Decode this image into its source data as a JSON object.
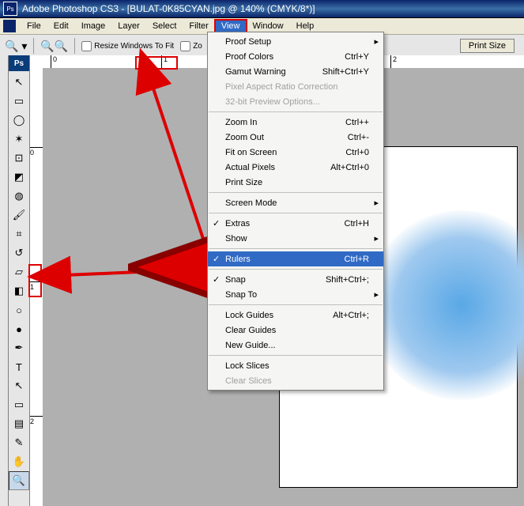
{
  "titlebar": {
    "icon": "Ps",
    "text": "Adobe Photoshop CS3 - [BULAT-0K85CYAN.jpg @ 140% (CMYK/8*)]"
  },
  "menubar": {
    "items": [
      "File",
      "Edit",
      "Image",
      "Layer",
      "Select",
      "Filter",
      "View",
      "Window",
      "Help"
    ],
    "active": 6
  },
  "optionsbar": {
    "resize": "Resize Windows To Fit",
    "zoom": "Zo",
    "printsize": "Print Size"
  },
  "view_menu": {
    "groups": [
      [
        {
          "label": "Proof Setup",
          "shortcut": "",
          "sub": true
        },
        {
          "label": "Proof Colors",
          "shortcut": "Ctrl+Y"
        },
        {
          "label": "Gamut Warning",
          "shortcut": "Shift+Ctrl+Y"
        },
        {
          "label": "Pixel Aspect Ratio Correction",
          "disabled": true
        },
        {
          "label": "32-bit Preview Options...",
          "disabled": true
        }
      ],
      [
        {
          "label": "Zoom In",
          "shortcut": "Ctrl++"
        },
        {
          "label": "Zoom Out",
          "shortcut": "Ctrl+-"
        },
        {
          "label": "Fit on Screen",
          "shortcut": "Ctrl+0"
        },
        {
          "label": "Actual Pixels",
          "shortcut": "Alt+Ctrl+0"
        },
        {
          "label": "Print Size"
        }
      ],
      [
        {
          "label": "Screen Mode",
          "sub": true
        }
      ],
      [
        {
          "label": "Extras",
          "shortcut": "Ctrl+H",
          "check": true
        },
        {
          "label": "Show",
          "sub": true
        }
      ],
      [
        {
          "label": "Rulers",
          "shortcut": "Ctrl+R",
          "check": true,
          "hl": true
        }
      ],
      [
        {
          "label": "Snap",
          "shortcut": "Shift+Ctrl+;",
          "check": true
        },
        {
          "label": "Snap To",
          "sub": true
        }
      ],
      [
        {
          "label": "Lock Guides",
          "shortcut": "Alt+Ctrl+;"
        },
        {
          "label": "Clear Guides"
        },
        {
          "label": "New Guide..."
        }
      ],
      [
        {
          "label": "Lock Slices"
        },
        {
          "label": "Clear Slices",
          "disabled": true
        }
      ]
    ]
  },
  "rulers": {
    "h": [
      "0",
      "1",
      "2"
    ],
    "v": [
      "0",
      "1",
      "2"
    ]
  },
  "tools": [
    {
      "name": "move-tool",
      "glyph": "↖"
    },
    {
      "name": "marquee-tool",
      "glyph": "▭"
    },
    {
      "name": "lasso-tool",
      "glyph": "◯"
    },
    {
      "name": "wand-tool",
      "glyph": "✶"
    },
    {
      "name": "crop-tool",
      "glyph": "⊡"
    },
    {
      "name": "slice-tool",
      "glyph": "◩"
    },
    {
      "name": "healing-tool",
      "glyph": "◍"
    },
    {
      "name": "brush-tool",
      "glyph": "🖌"
    },
    {
      "name": "stamp-tool",
      "glyph": "⌗"
    },
    {
      "name": "history-tool",
      "glyph": "↺"
    },
    {
      "name": "eraser-tool",
      "glyph": "▱"
    },
    {
      "name": "gradient-tool",
      "glyph": "◧"
    },
    {
      "name": "dodge-tool",
      "glyph": "○"
    },
    {
      "name": "blur-tool",
      "glyph": "●"
    },
    {
      "name": "pen-tool",
      "glyph": "✒"
    },
    {
      "name": "type-tool",
      "glyph": "T"
    },
    {
      "name": "path-tool",
      "glyph": "↖"
    },
    {
      "name": "shape-tool",
      "glyph": "▭"
    },
    {
      "name": "notes-tool",
      "glyph": "▤"
    },
    {
      "name": "eyedropper-tool",
      "glyph": "✎"
    },
    {
      "name": "hand-tool",
      "glyph": "✋"
    },
    {
      "name": "zoom-tool",
      "glyph": "🔍",
      "sel": true
    }
  ]
}
